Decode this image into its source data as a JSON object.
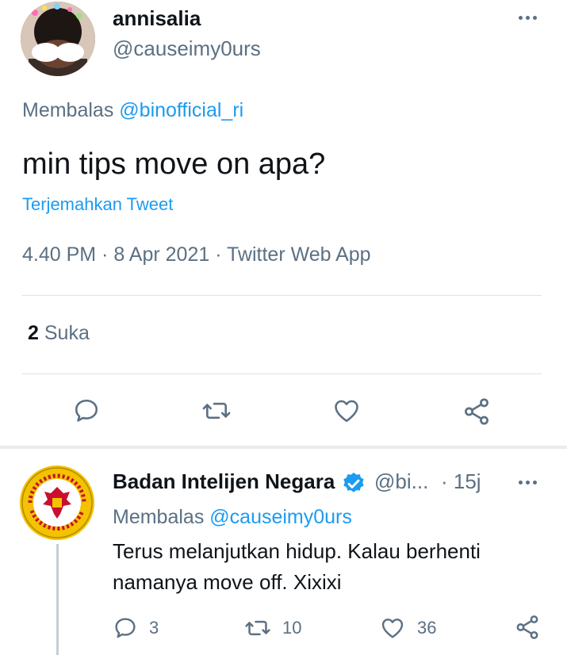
{
  "main_tweet": {
    "author_name": "annisalia",
    "author_handle": "@causeimy0urs",
    "replying_prefix": "Membalas",
    "replying_to": "@binofficial_ri",
    "text": "min tips move on apa?",
    "translate_label": "Terjemahkan Tweet",
    "timestamp": "4.40 PM · 8 Apr 2021 · Twitter Web App",
    "likes_count": "2",
    "likes_label": "Suka",
    "actions": [
      "reply-icon",
      "retweet-icon",
      "like-icon",
      "share-icon"
    ]
  },
  "reply_tweet": {
    "author_name": "Badan Intelijen Negara",
    "verified": true,
    "author_handle": "@bi...",
    "time": "· 15j",
    "replying_prefix": "Membalas",
    "replying_to": "@causeimy0urs",
    "text": "Terus melanjutkan hidup. Kalau berhenti namanya move off. Xixixi",
    "avatar_text": "BADAN INTELIJEN NEGARA · REPUBLIK INDONESIA",
    "reply_count": "3",
    "retweet_count": "10",
    "like_count": "36"
  },
  "colors": {
    "accent": "#1d9bf0",
    "secondary_text": "#5b7083",
    "primary_text": "#0f1419",
    "divider": "#dde3e8",
    "icon": "#5b7083"
  }
}
